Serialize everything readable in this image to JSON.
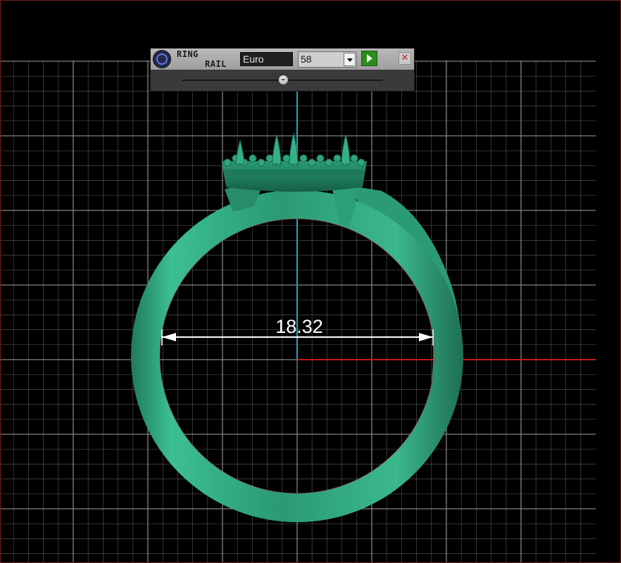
{
  "toolbar": {
    "title_line1": "RING",
    "title_line2": "RAIL",
    "icon": "ring-logo-icon",
    "size_standard": "Euro",
    "size_value": "58",
    "apply_icon": "play-icon",
    "close_icon": "close-icon",
    "slider_level": 0.5
  },
  "viewport": {
    "dimension_label": "18.32",
    "colors": {
      "background": "#000000",
      "grid": "#9a9a9a",
      "vertical_axis": "#1fa3c4",
      "horizontal_axis": "#c21b1b",
      "ring": "#2fa57c"
    }
  }
}
